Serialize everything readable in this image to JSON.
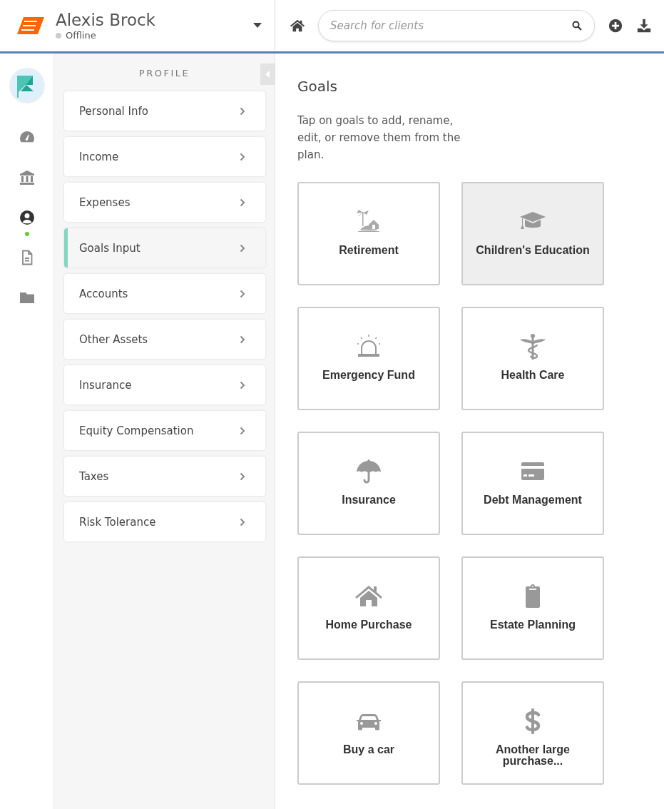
{
  "header": {
    "user_name": "Alexis Brock",
    "status": "Offline",
    "online": false,
    "search": {
      "placeholder": "Search for clients"
    }
  },
  "rail": [
    {
      "kind": "dashboard",
      "selected": false
    },
    {
      "kind": "bank",
      "selected": false
    },
    {
      "kind": "user",
      "selected": true
    },
    {
      "kind": "document",
      "selected": false
    },
    {
      "kind": "folder",
      "selected": false
    }
  ],
  "profile": {
    "title": "PROFILE",
    "items": [
      {
        "label": "Personal Info",
        "selected": false
      },
      {
        "label": "Income",
        "selected": false
      },
      {
        "label": "Expenses",
        "selected": false
      },
      {
        "label": "Goals Input",
        "selected": true
      },
      {
        "label": "Accounts",
        "selected": false
      },
      {
        "label": "Other Assets",
        "selected": false
      },
      {
        "label": "Insurance",
        "selected": false
      },
      {
        "label": "Equity Compensation",
        "selected": false
      },
      {
        "label": "Taxes",
        "selected": false
      },
      {
        "label": "Risk Tolerance",
        "selected": false
      }
    ]
  },
  "goals": {
    "title": "Goals",
    "description": "Tap on goals to add, rename, edit, or remove them from the plan.",
    "tiles": [
      {
        "label": "Retirement",
        "kind": "island",
        "selected": false
      },
      {
        "label": "Children's Education",
        "kind": "graduation",
        "selected": true
      },
      {
        "label": "Emergency Fund",
        "kind": "siren",
        "selected": false
      },
      {
        "label": "Health Care",
        "kind": "caduceus",
        "selected": false
      },
      {
        "label": "Insurance",
        "kind": "umbrella",
        "selected": false
      },
      {
        "label": "Debt Management",
        "kind": "card",
        "selected": false
      },
      {
        "label": "Home Purchase",
        "kind": "house",
        "selected": false
      },
      {
        "label": "Estate Planning",
        "kind": "clipboard",
        "selected": false
      },
      {
        "label": "Buy a car",
        "kind": "car",
        "selected": false
      },
      {
        "label": "Another large purchase...",
        "kind": "dollar",
        "selected": false
      }
    ]
  }
}
